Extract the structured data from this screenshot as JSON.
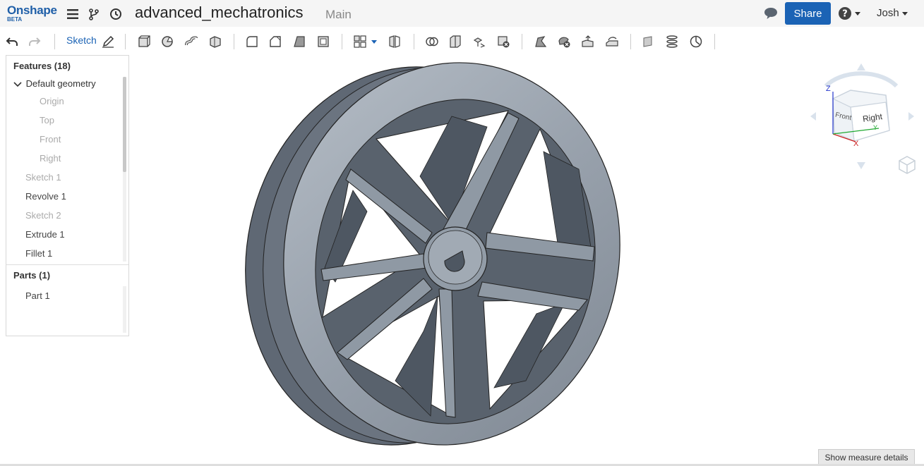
{
  "header": {
    "logo_main": "Onshape",
    "logo_sub": "BETA",
    "document_title": "advanced_mechatronics",
    "branch": "Main",
    "share_label": "Share",
    "user_name": "Josh",
    "icons": [
      "menu-icon",
      "branch-icon",
      "history-icon",
      "comment-icon",
      "help-icon"
    ]
  },
  "toolbar": {
    "sketch_label": "Sketch"
  },
  "features": {
    "title": "Features (18)",
    "group_label": "Default geometry",
    "items": [
      {
        "label": "Origin",
        "state": "dimmed"
      },
      {
        "label": "Top",
        "state": "dimmed"
      },
      {
        "label": "Front",
        "state": "dimmed"
      },
      {
        "label": "Right",
        "state": "dimmed"
      },
      {
        "label": "Sketch 1",
        "state": "dimmed"
      },
      {
        "label": "Revolve 1",
        "state": "normal"
      },
      {
        "label": "Sketch 2",
        "state": "dimmed"
      },
      {
        "label": "Extrude 1",
        "state": "normal"
      },
      {
        "label": "Fillet 1",
        "state": "normal"
      }
    ]
  },
  "parts": {
    "title": "Parts (1)",
    "items": [
      "Part 1"
    ]
  },
  "view_cube": {
    "front_label": "Front",
    "right_label": "Right",
    "z_label": "Z",
    "x_label": "X",
    "y_label": "Y"
  },
  "viewport": {
    "measure_label": "Show measure details"
  },
  "colors": {
    "brand": "#1b63b5",
    "model_face": "#8e98a4",
    "model_dark": "#5f6874"
  }
}
